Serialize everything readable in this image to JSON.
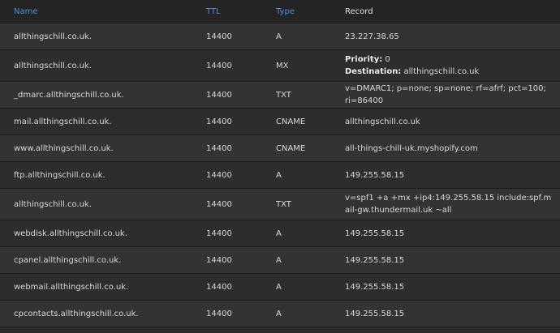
{
  "headers": {
    "name": "Name",
    "ttl": "TTL",
    "type": "Type",
    "record": "Record"
  },
  "rows": [
    {
      "name": "allthingschill.co.uk.",
      "ttl": "14400",
      "type": "A",
      "record": "23.227.38.65"
    },
    {
      "name": "allthingschill.co.uk.",
      "ttl": "14400",
      "type": "MX",
      "priority_label": "Priority:",
      "priority": "0",
      "dest_label": "Destination:",
      "dest": "allthingschill.co.uk"
    },
    {
      "name": "_dmarc.allthingschill.co.uk.",
      "ttl": "14400",
      "type": "TXT",
      "record": "v=DMARC1; p=none; sp=none; rf=afrf; pct=100; ri=86400"
    },
    {
      "name": "mail.allthingschill.co.uk.",
      "ttl": "14400",
      "type": "CNAME",
      "record": "allthingschill.co.uk"
    },
    {
      "name": "www.allthingschill.co.uk.",
      "ttl": "14400",
      "type": "CNAME",
      "record": "all-things-chill-uk.myshopify.com"
    },
    {
      "name": "ftp.allthingschill.co.uk.",
      "ttl": "14400",
      "type": "A",
      "record": "149.255.58.15"
    },
    {
      "name": "allthingschill.co.uk.",
      "ttl": "14400",
      "type": "TXT",
      "record": "v=spf1 +a +mx +ip4:149.255.58.15 include:spf.mail-gw.thundermail.uk ~all"
    },
    {
      "name": "webdisk.allthingschill.co.uk.",
      "ttl": "14400",
      "type": "A",
      "record": "149.255.58.15"
    },
    {
      "name": "cpanel.allthingschill.co.uk.",
      "ttl": "14400",
      "type": "A",
      "record": "149.255.58.15"
    },
    {
      "name": "webmail.allthingschill.co.uk.",
      "ttl": "14400",
      "type": "A",
      "record": "149.255.58.15"
    },
    {
      "name": "cpcontacts.allthingschill.co.uk.",
      "ttl": "14400",
      "type": "A",
      "record": "149.255.58.15"
    }
  ]
}
